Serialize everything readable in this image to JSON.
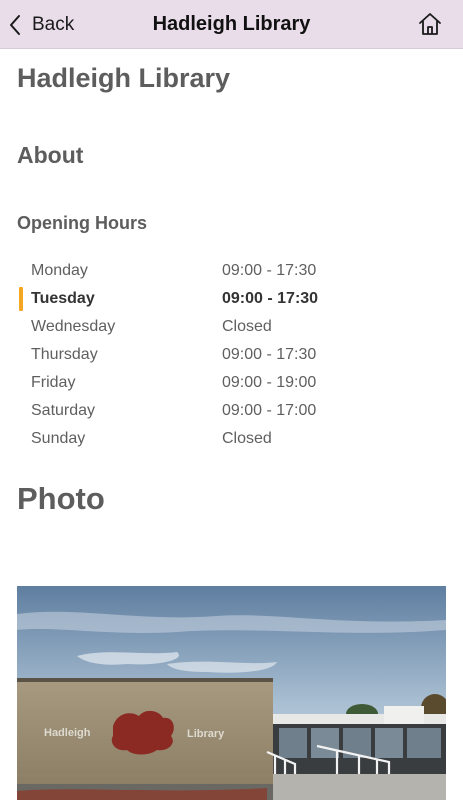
{
  "navbar": {
    "back_label": "Back",
    "title": "Hadleigh Library",
    "home_icon": "home-icon",
    "back_icon": "chevron-left-icon",
    "background": "#e9dde9"
  },
  "page": {
    "library_name": "Hadleigh Library",
    "about_heading": "About",
    "hours_heading": "Opening Hours",
    "photo_heading": "Photo"
  },
  "hours": [
    {
      "day": "Monday",
      "time": "09:00 - 17:30",
      "today": false
    },
    {
      "day": "Tuesday",
      "time": "09:00 - 17:30",
      "today": true
    },
    {
      "day": "Wednesday",
      "time": "Closed",
      "today": false
    },
    {
      "day": "Thursday",
      "time": "09:00 - 17:30",
      "today": false
    },
    {
      "day": "Friday",
      "time": "09:00 - 19:00",
      "today": false
    },
    {
      "day": "Saturday",
      "time": "09:00 - 17:00",
      "today": false
    },
    {
      "day": "Sunday",
      "time": "Closed",
      "today": false
    }
  ],
  "photo": {
    "sign_left": "Hadleigh",
    "sign_right": "Library"
  },
  "colors": {
    "today_marker": "#f5a623",
    "heading": "#5d5d5d"
  }
}
